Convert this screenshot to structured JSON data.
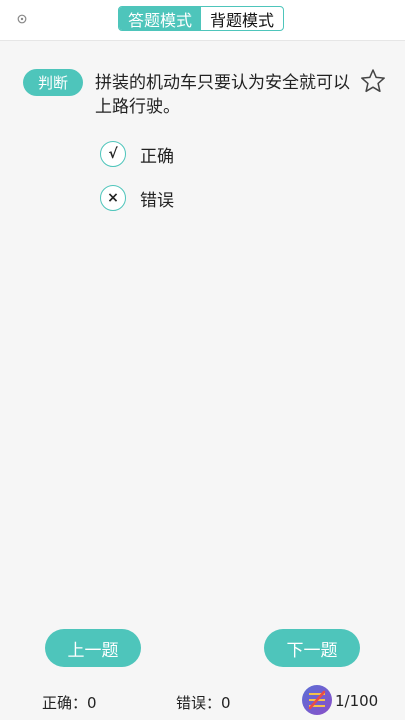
{
  "header": {
    "modes": [
      {
        "label": "答题模式",
        "active": true
      },
      {
        "label": "背题模式",
        "active": false
      }
    ]
  },
  "question": {
    "type_badge": "判断",
    "text": "拼装的机动车只要认为安全就可以上路行驶。",
    "options": [
      {
        "symbol": "√",
        "label": "正确"
      },
      {
        "symbol": "×",
        "label": "错误"
      }
    ]
  },
  "navigation": {
    "prev_label": "上一题",
    "next_label": "下一题"
  },
  "footer": {
    "correct_text": "正确：0",
    "wrong_text": "错误：0",
    "progress_text": "1/100"
  },
  "colors": {
    "accent": "#4ec5bb",
    "background": "#f6f6f6"
  },
  "icons": {
    "back": "back-icon",
    "star": "star-outline-icon",
    "answer_card": "answer-card-icon"
  }
}
